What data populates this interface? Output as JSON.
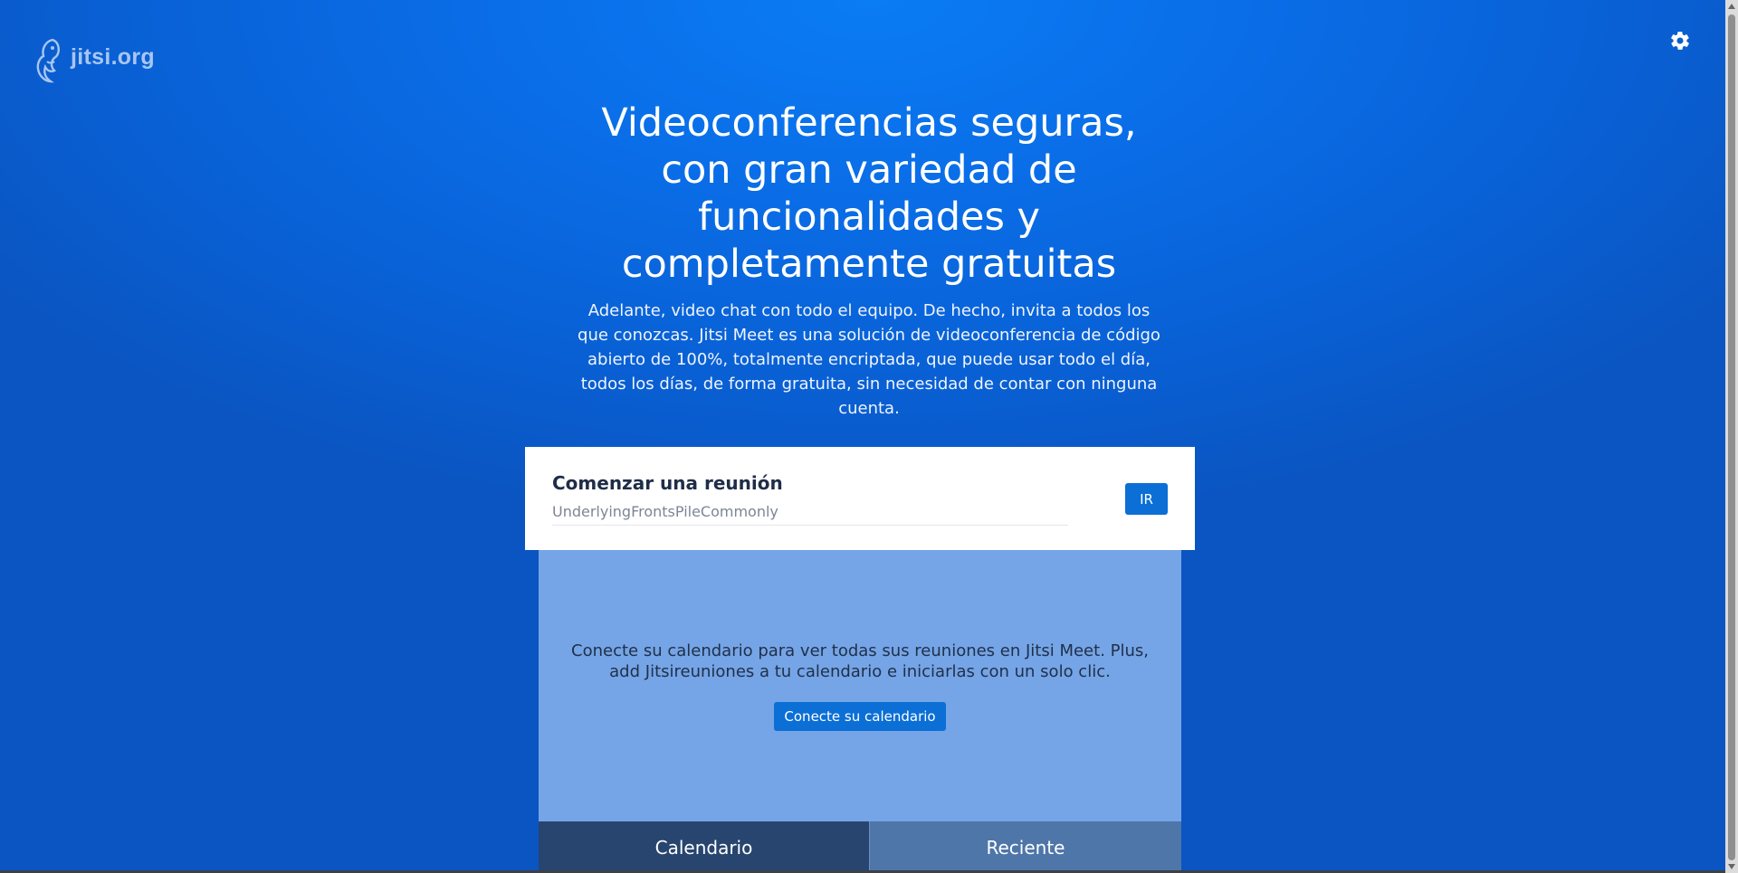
{
  "header": {
    "logo_text": "jitsi.org",
    "logo_icon": "jitsi-mascot-icon",
    "settings_icon": "gear-icon"
  },
  "hero": {
    "title": "Videoconferencias seguras, con gran variedad de funcionalidades y completamente gratuitas",
    "description": "Adelante, video chat con todo el equipo. De hecho, invita a todos los que conozcas. Jitsi Meet es una solución de videoconferencia de código abierto de 100%, totalmente encriptada, que puede usar todo el día, todos los días, de forma gratuita, sin necesidad de contar con ninguna cuenta."
  },
  "start_meeting": {
    "title": "Comenzar una reunión",
    "room_name_value": "UnderlyingFrontsPileCommonly",
    "go_label": "IR"
  },
  "calendar": {
    "message": "Conecte su calendario para ver todas sus reuniones en Jitsi Meet. Plus, add Jitsireuniones a tu calendario e iniciarlas con un solo clic.",
    "connect_label": "Conecte su calendario"
  },
  "tabs": [
    {
      "label": "Calendario",
      "active": true
    },
    {
      "label": "Reciente",
      "active": false
    }
  ],
  "colors": {
    "background": "#0a6ee8",
    "button": "#0b6fd6",
    "calendar_panel": "#75a5e6",
    "tab_active": "#27456f",
    "tab_inactive": "#4e76a9"
  }
}
